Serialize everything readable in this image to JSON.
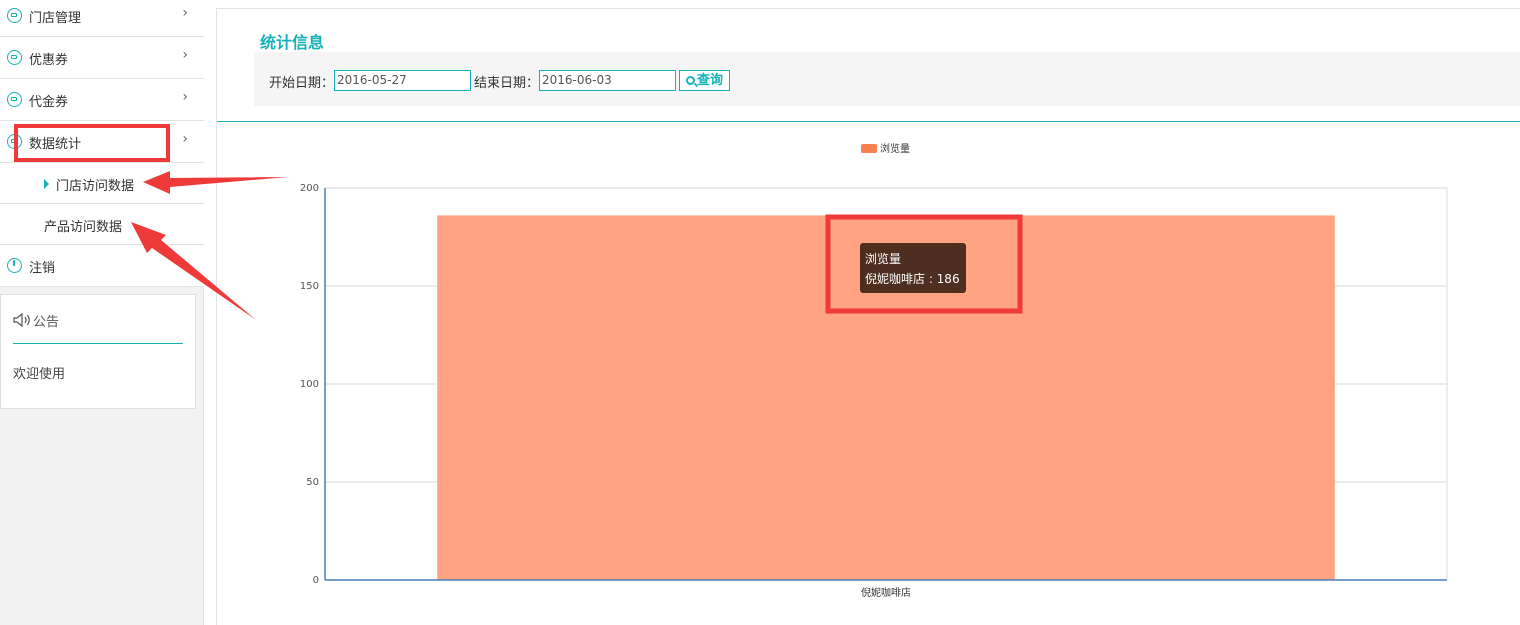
{
  "sidebar": {
    "items": [
      {
        "label": "门店管理",
        "chevron": "›",
        "icon": "store-icon"
      },
      {
        "label": "优惠券",
        "chevron": "›",
        "icon": "coupon-icon"
      },
      {
        "label": "代金券",
        "chevron": "›",
        "icon": "voucher-icon"
      },
      {
        "label": "数据统计",
        "chevron": "›",
        "icon": "statistics-icon"
      }
    ],
    "subitems": [
      {
        "label": "门店访问数据",
        "active": true
      },
      {
        "label": "产品访问数据",
        "active": false
      }
    ],
    "logout": {
      "label": "注销",
      "icon": "power-icon"
    },
    "notice": {
      "title": "公告",
      "body": "欢迎使用",
      "icon": "speaker-icon"
    }
  },
  "main": {
    "title": "统计信息",
    "start_label": "开始日期：",
    "start_value": "2016-05-27",
    "end_label": "结束日期：",
    "end_value": "2016-06-03",
    "search_label": "查询"
  },
  "tooltip": {
    "series": "浏览量",
    "line": "倪妮咖啡店 : 186"
  },
  "colors": {
    "accent": "#17b2b8",
    "bar": "#ffa383",
    "legend": "#f5814f",
    "annotation": "#ef3a3a",
    "tooltip_bg": "#4d2e1f"
  },
  "chart_data": {
    "type": "bar",
    "categories": [
      "倪妮咖啡店"
    ],
    "series": [
      {
        "name": "浏览量",
        "values": [
          186
        ]
      }
    ],
    "ylim": [
      0,
      200
    ],
    "yticks": [
      0,
      50,
      100,
      150,
      200
    ],
    "grid": true,
    "legend": "top-center"
  }
}
